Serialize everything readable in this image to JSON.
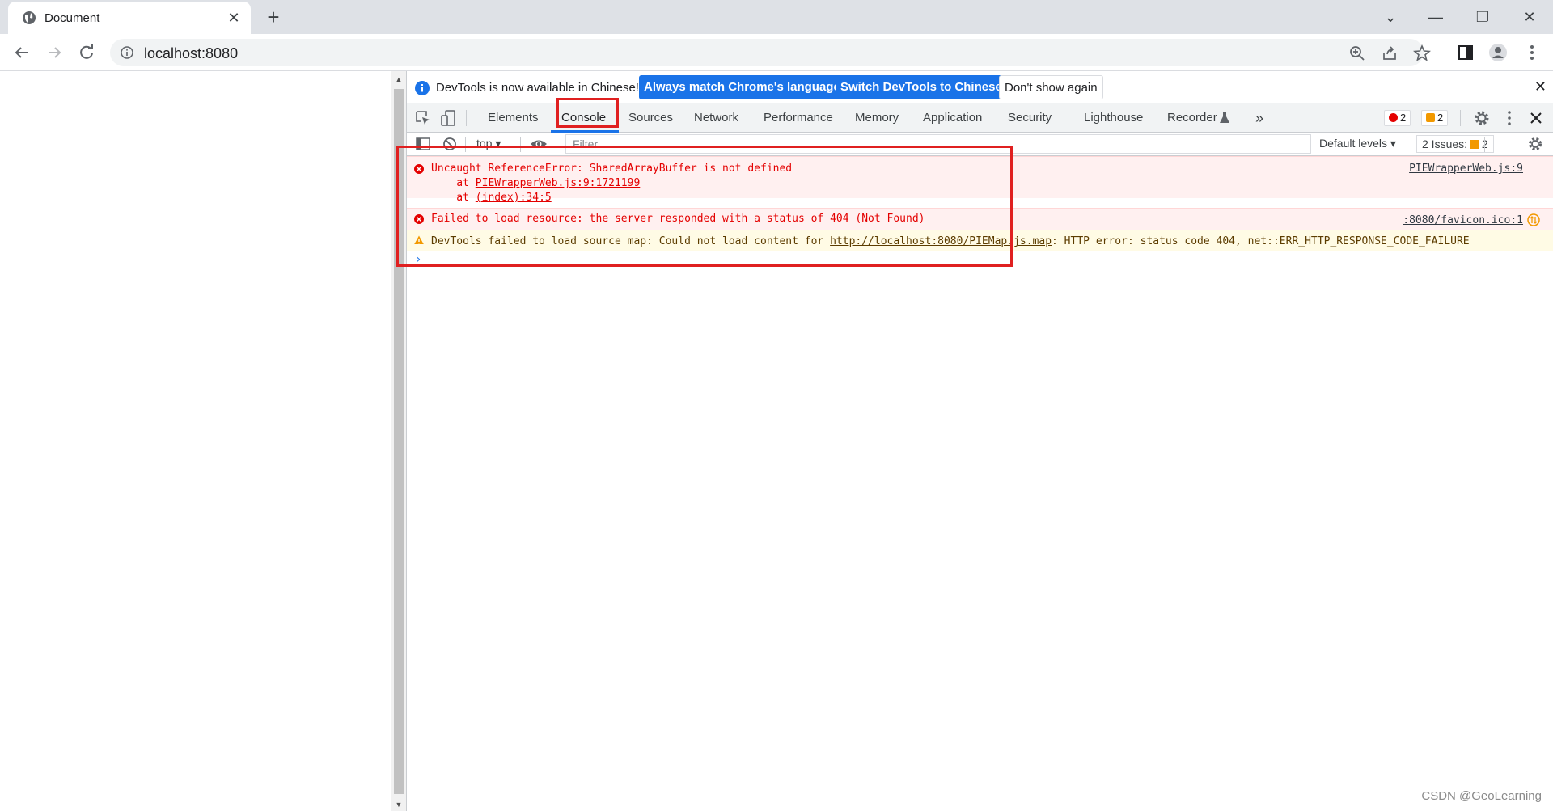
{
  "browser": {
    "tab_title": "Document",
    "tab_close": "✕",
    "new_tab": "+",
    "window_controls": [
      "⌄",
      "—",
      "❐",
      "✕"
    ],
    "url": "localhost:8080"
  },
  "infobar": {
    "message": "DevTools is now available in Chinese!",
    "btn_match": "Always match Chrome's language",
    "btn_switch": "Switch DevTools to Chinese",
    "btn_dismiss": "Don't show again",
    "close": "✕"
  },
  "devtools_tabs": [
    "Elements",
    "Console",
    "Sources",
    "Network",
    "Performance",
    "Memory",
    "Application",
    "Security",
    "Lighthouse",
    "Recorder"
  ],
  "more_tabs": "»",
  "counters": {
    "errors": "2",
    "warnings": "2"
  },
  "console_toolbar": {
    "context": "top",
    "filter_placeholder": "Filter",
    "levels": "Default levels",
    "issues_label": "2 Issues:",
    "issues_count": "2"
  },
  "messages": [
    {
      "level": "error",
      "lines": [
        "Uncaught ReferenceError: SharedArrayBuffer is not defined"
      ],
      "stack": [
        {
          "prefix": "    at ",
          "link": "PIEWrapperWeb.js:9:1721199"
        },
        {
          "prefix": "    at ",
          "link": "(index):34:5"
        }
      ],
      "source": "PIEWrapperWeb.js:9"
    },
    {
      "level": "error",
      "text": "Failed to load resource: the server responded with a status of 404 (Not Found)",
      "source": ":8080/favicon.ico:1"
    },
    {
      "level": "warning",
      "text_before": "DevTools failed to load source map: Could not load content for ",
      "link": "http://localhost:8080/PIEMap.js.map",
      "text_after": ": HTTP error: status code 404, net::ERR_HTTP_RESPONSE_CODE_FAILURE"
    }
  ],
  "prompt": "›",
  "watermark": "CSDN @GeoLearning",
  "colors": {
    "accent": "#1a73e8",
    "error": "#e40000",
    "warning_icon": "#f29900",
    "annotation": "#e02020"
  }
}
